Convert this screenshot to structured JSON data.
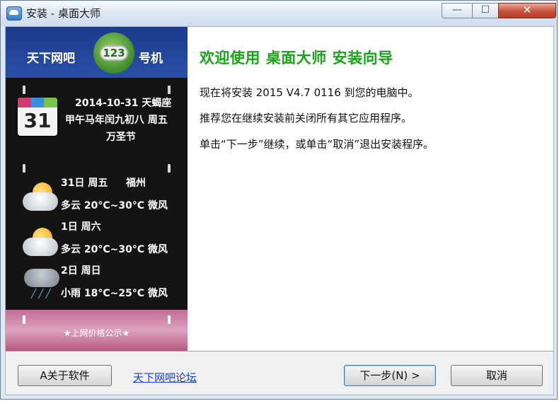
{
  "window": {
    "title": "安装 - 桌面大师",
    "minimize_glyph": "—",
    "maximize_glyph": "☐",
    "close_glyph": "✕"
  },
  "banner": {
    "brand_left": "天下网吧",
    "badge_number": "123",
    "brand_right": "号机",
    "calendar": {
      "day": "31",
      "line1": "2014-10-31 天蝎座",
      "line2": "甲午马年闰九初八 周五",
      "line3": "万圣节"
    },
    "weather": [
      {
        "date": "31日 周五",
        "city": "福州",
        "desc": "多云 20°C~30°C 微风",
        "icon": "partly-cloudy-icon"
      },
      {
        "date": "1日 周六",
        "city": "",
        "desc": "多云 20°C~30°C 微风",
        "icon": "partly-cloudy-icon"
      },
      {
        "date": "2日 周日",
        "city": "",
        "desc": "小雨 18°C~25°C 微风",
        "icon": "light-rain-icon"
      }
    ],
    "bottom_text": "★上网价格公示★"
  },
  "content": {
    "heading": "欢迎使用 桌面大师 安装向导",
    "line1": "现在将安装 2015 V4.7 0116 到您的电脑中。",
    "line2": "推荐您在继续安装前关闭所有其它应用程序。",
    "line3": "单击“下一步”继续，或单击“取消”退出安装程序。"
  },
  "footer": {
    "about_button": "A关于软件",
    "forum_link": "天下网吧论坛",
    "next_button": "下一步(N) >",
    "cancel_button": "取消"
  }
}
